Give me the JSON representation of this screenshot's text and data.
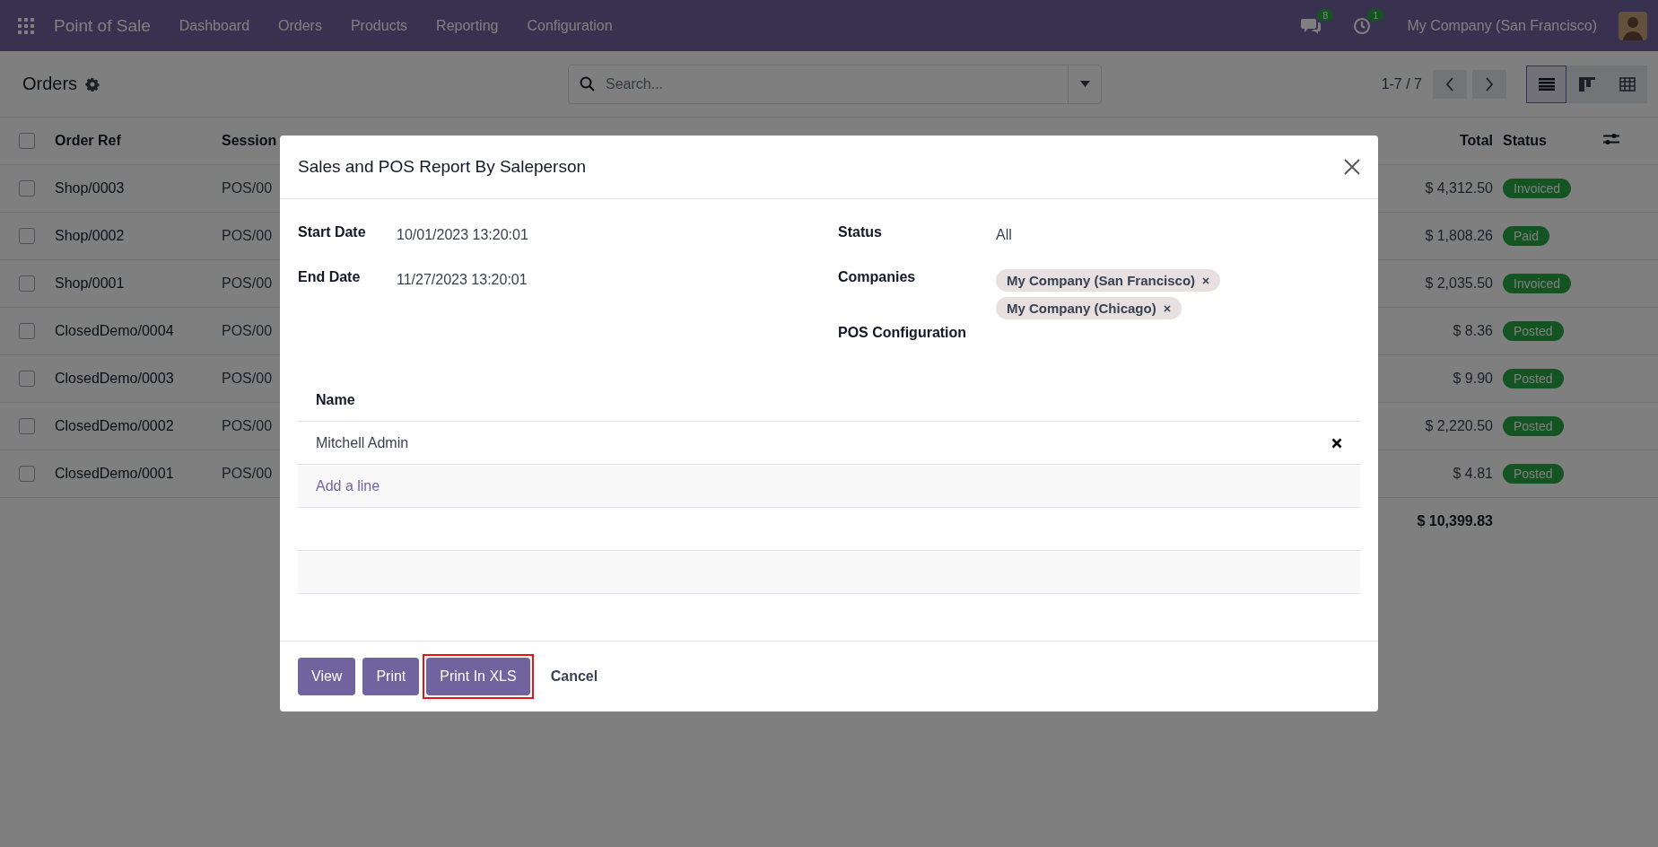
{
  "navbar": {
    "app_name": "Point of Sale",
    "menu": [
      "Dashboard",
      "Orders",
      "Products",
      "Reporting",
      "Configuration"
    ],
    "messages_count": "8",
    "activities_count": "1",
    "company": "My Company (San Francisco)"
  },
  "control_panel": {
    "title": "Orders",
    "search": {
      "placeholder": "Search..."
    },
    "pager": "1-7 / 7",
    "views": [
      {
        "kind": "list",
        "selected": true
      },
      {
        "kind": "kanban",
        "selected": false
      },
      {
        "kind": "pivot",
        "selected": false
      }
    ]
  },
  "table": {
    "all_selected": false,
    "columns": [
      "Order Ref",
      "Session",
      "Total",
      "Status"
    ],
    "rows": [
      {
        "order_ref": "Shop/0003",
        "session": "POS/00",
        "total": "$ 4,312.50",
        "status": "Invoiced",
        "selected": false
      },
      {
        "order_ref": "Shop/0002",
        "session": "POS/00",
        "total": "$ 1,808.26",
        "status": "Paid",
        "selected": false
      },
      {
        "order_ref": "Shop/0001",
        "session": "POS/00",
        "total": "$ 2,035.50",
        "status": "Invoiced",
        "selected": false
      },
      {
        "order_ref": "ClosedDemo/0004",
        "session": "POS/00",
        "total": "$ 8.36",
        "status": "Posted",
        "selected": false
      },
      {
        "order_ref": "ClosedDemo/0003",
        "session": "POS/00",
        "total": "$ 9.90",
        "status": "Posted",
        "selected": false
      },
      {
        "order_ref": "ClosedDemo/0002",
        "session": "POS/00",
        "total": "$ 2,220.50",
        "status": "Posted",
        "selected": false
      },
      {
        "order_ref": "ClosedDemo/0001",
        "session": "POS/00",
        "total": "$ 4.81",
        "status": "Posted",
        "selected": false
      }
    ],
    "footer_total": "$ 10,399.83"
  },
  "dialog": {
    "title": "Sales and POS Report By Saleperson",
    "left_fields": [
      {
        "label": "Start Date",
        "value": "10/01/2023 13:20:01"
      },
      {
        "label": "End Date",
        "value": "11/27/2023 13:20:01"
      }
    ],
    "status": {
      "label": "Status",
      "value": "All"
    },
    "companies": {
      "label": "Companies",
      "tags": [
        "My Company (San Francisco)",
        "My Company (Chicago)"
      ]
    },
    "pos_configuration": {
      "label": "POS Configuration"
    },
    "lines": {
      "column": "Name",
      "rows": [
        "Mitchell Admin"
      ],
      "add_line": "Add a line"
    },
    "buttons": [
      {
        "label": "View",
        "kind": "primary",
        "highlighted": false
      },
      {
        "label": "Print",
        "kind": "primary",
        "highlighted": false
      },
      {
        "label": "Print In XLS",
        "kind": "primary",
        "highlighted": true
      },
      {
        "label": "Cancel",
        "kind": "secondary",
        "highlighted": false
      }
    ]
  }
}
